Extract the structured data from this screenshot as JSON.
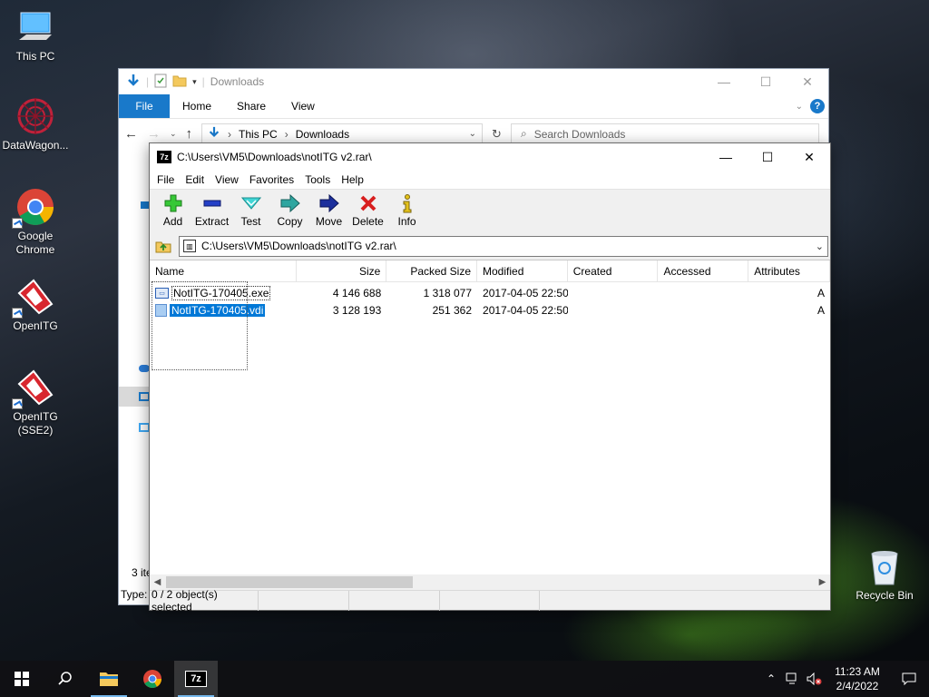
{
  "desktop": {
    "icons": [
      {
        "label": "This PC",
        "icon": "this-pc-icon"
      },
      {
        "label": "DataWagon...",
        "icon": "datawagon-icon"
      },
      {
        "label": "Google Chrome",
        "icon": "chrome-icon"
      },
      {
        "label": "OpenITG",
        "icon": "openitg-icon"
      },
      {
        "label": "OpenITG (SSE2)",
        "icon": "openitg-sse2-icon"
      },
      {
        "label": "Recycle Bin",
        "icon": "recycle-bin-icon"
      }
    ]
  },
  "explorer": {
    "title": "Downloads",
    "ribbon_tabs": [
      "File",
      "Home",
      "Share",
      "View"
    ],
    "breadcrumb": [
      "This PC",
      "Downloads"
    ],
    "search_placeholder": "Search Downloads",
    "status_items": "3 ite",
    "status_type": "Type:"
  },
  "sevenzip": {
    "title": "C:\\Users\\VM5\\Downloads\\notITG v2.rar\\",
    "menu": [
      "File",
      "Edit",
      "View",
      "Favorites",
      "Tools",
      "Help"
    ],
    "toolbar": [
      {
        "label": "Add",
        "icon": "add-icon"
      },
      {
        "label": "Extract",
        "icon": "extract-icon"
      },
      {
        "label": "Test",
        "icon": "test-icon"
      },
      {
        "label": "Copy",
        "icon": "copy-icon"
      },
      {
        "label": "Move",
        "icon": "move-icon"
      },
      {
        "label": "Delete",
        "icon": "delete-icon"
      },
      {
        "label": "Info",
        "icon": "info-icon"
      }
    ],
    "address": "C:\\Users\\VM5\\Downloads\\notITG v2.rar\\",
    "columns": [
      "Name",
      "Size",
      "Packed Size",
      "Modified",
      "Created",
      "Accessed",
      "Attributes"
    ],
    "files": [
      {
        "name": "NotITG-170405.exe",
        "size": "4 146 688",
        "packed": "1 318 077",
        "modified": "2017-04-05 22:50",
        "created": "",
        "accessed": "",
        "attr": "A"
      },
      {
        "name": "NotITG-170405.vdi",
        "size": "3 128 193",
        "packed": "251 362",
        "modified": "2017-04-05 22:50",
        "created": "",
        "accessed": "",
        "attr": "A"
      }
    ],
    "status": "0 / 2 object(s) selected"
  },
  "taskbar": {
    "time": "11:23 AM",
    "date": "2/4/2022"
  },
  "colors": {
    "accent": "#0078d7",
    "ribbon_file": "#1979ca"
  }
}
